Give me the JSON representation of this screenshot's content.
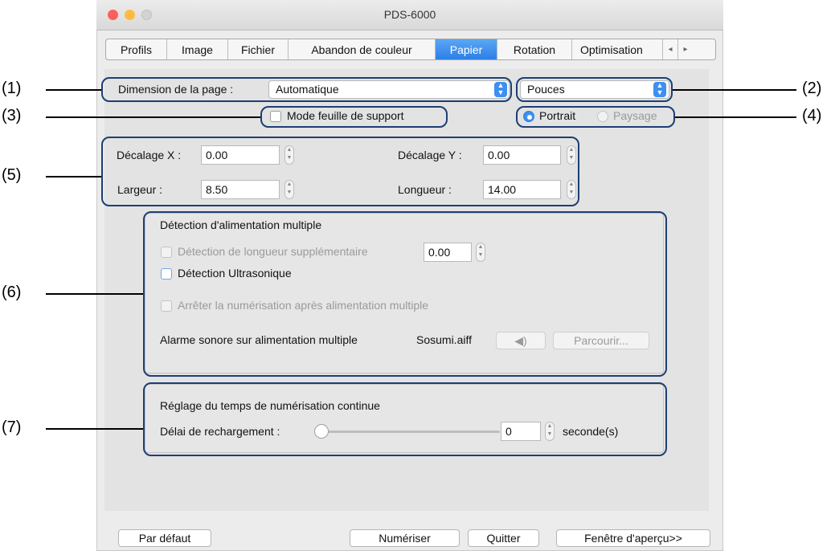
{
  "window": {
    "title": "PDS-6000",
    "traffic_lights": {
      "close": "#fc605c",
      "minimize": "#fdbc40",
      "zoom": "#cfcfcf"
    }
  },
  "tabs": [
    {
      "label": "Profils",
      "active": false
    },
    {
      "label": "Image",
      "active": false
    },
    {
      "label": "Fichier",
      "active": false
    },
    {
      "label": "Abandon de couleur",
      "active": false
    },
    {
      "label": "Papier",
      "active": true
    },
    {
      "label": "Rotation",
      "active": false
    },
    {
      "label": "Optimisation",
      "active": false
    }
  ],
  "tab_scroll": {
    "left_icon": "◂",
    "right_icon": "▸"
  },
  "page_size": {
    "label": "Dimension de la page :",
    "value": "Automatique"
  },
  "units": {
    "value": "Pouces"
  },
  "carrier_sheet": {
    "label": "Mode feuille de support",
    "checked": false
  },
  "orientation": {
    "portrait": "Portrait",
    "landscape": "Paysage",
    "selected": "Portrait"
  },
  "offsets": {
    "x_label": "Décalage X :",
    "x_value": "0.00",
    "y_label": "Décalage Y :",
    "y_value": "0.00",
    "width_label": "Largeur :",
    "width_value": "8.50",
    "length_label": "Longueur :",
    "length_value": "14.00"
  },
  "multifeed": {
    "title": "Détection d'alimentation multiple",
    "length_detection_label": "Détection de longueur supplémentaire",
    "length_detection_value": "0.00",
    "ultrasonic_label": "Détection Ultrasonique",
    "stop_label": "Arrêter la numérisation après alimentation multiple",
    "alarm_label": "Alarme sonore sur alimentation multiple",
    "alarm_file": "Sosumi.aiff",
    "sound_icon": "speaker-icon",
    "browse_label": "Parcourir..."
  },
  "continuous": {
    "title": "Réglage du temps de numérisation continue",
    "delay_label": "Délai de rechargement :",
    "delay_value": "0",
    "unit": "seconde(s)",
    "slider_level": 0
  },
  "footer": {
    "default_button": "Par défaut",
    "scan_button": "Numériser",
    "quit_button": "Quitter",
    "preview_button": "Fenêtre d'aperçu>>"
  },
  "callouts": [
    "(1)",
    "(2)",
    "(3)",
    "(4)",
    "(5)",
    "(6)",
    "(7)"
  ],
  "colors": {
    "accent": "#2d7fe6",
    "callout_border": "#1d3f73"
  }
}
